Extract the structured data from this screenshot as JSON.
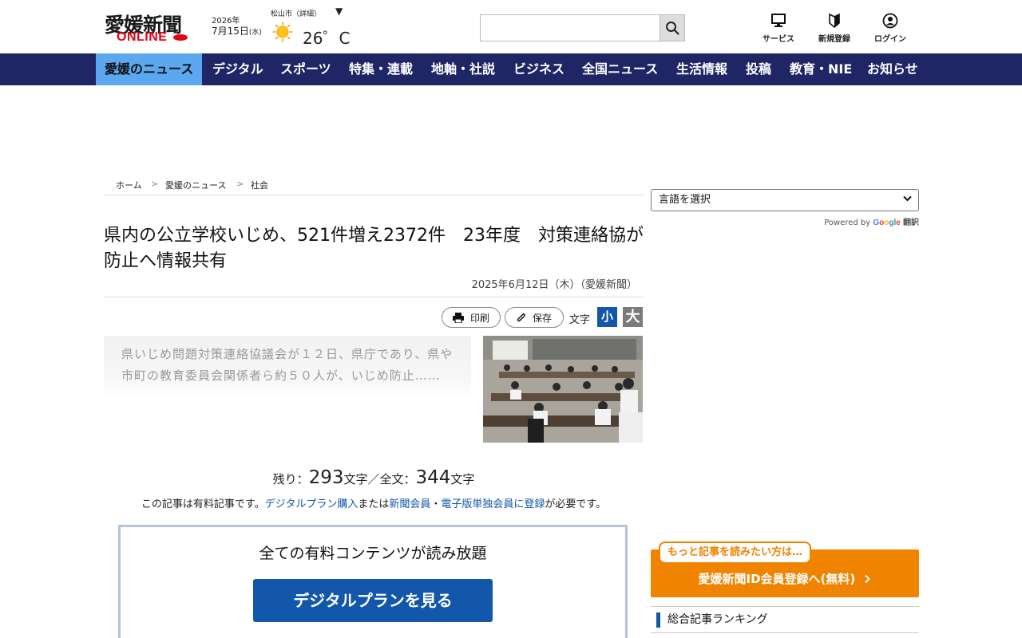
{
  "header": {
    "logo_text": "愛媛新聞",
    "logo_sub": "ONLINE",
    "date_year": "2026年",
    "date_month_day": "7月15日",
    "date_weekday": "(水)",
    "weather_city": "松山市（詳細）",
    "weather_icon": "sun-icon",
    "temperature": "26゜C",
    "search_placeholder": "",
    "icons": [
      {
        "label": "サービス",
        "icon": "monitor-icon"
      },
      {
        "label": "新規登録",
        "icon": "beginner-mark-icon"
      },
      {
        "label": "ログイン",
        "icon": "user-icon"
      }
    ]
  },
  "nav": {
    "items": [
      "愛媛のニュース",
      "デジタル",
      "スポーツ",
      "特集・連載",
      "地軸・社説",
      "ビジネス",
      "全国ニュース",
      "生活情報",
      "投稿",
      "教育・NIE",
      "お知らせ"
    ],
    "active_index": 0
  },
  "breadcrumb": {
    "items": [
      "ホーム",
      "愛媛のニュース",
      "社会"
    ],
    "separator": ">"
  },
  "article": {
    "title": "県内の公立学校いじめ、521件増え2372件　23年度　対策連絡協が防止へ情報共有",
    "published": "2025年6月12日（木）（愛媛新聞）",
    "tools": {
      "print_label": "印刷",
      "save_label": "保存",
      "font_label": "文字",
      "font_small": "小",
      "font_large": "大"
    },
    "teaser": "県いじめ問題対策連絡協議会が１２日、県庁であり、県や市町の教育委員会関係者ら約５０人が、いじめ防止……",
    "remaining_prefix": "残り：",
    "remaining_count": "293",
    "remaining_mid": "文字／全文：",
    "total_count": "344",
    "remaining_suffix": "文字",
    "paid_note": {
      "before": "この記事は有料記事です。",
      "link1": "デジタルプラン購入",
      "mid1": "または",
      "link2": "新聞会員",
      "mid2": "・",
      "link3": "電子版単独会員に登録",
      "after": "が必要です。"
    },
    "plan_heading": "全ての有料コンテンツが読み放題",
    "plan_button": "デジタルプランを見る"
  },
  "sidebar": {
    "language_select": "言語を選択",
    "powered_by": "Powered by",
    "google_translate": "翻訳",
    "register_bubble": "もっと記事を読みたい方は…",
    "register_text": "愛媛新聞ID会員登録へ(無料)",
    "ranking_heading": "総合記事ランキング"
  },
  "colors": {
    "nav_bg": "#1f2565",
    "nav_active": "#5ba8f0",
    "brand_red": "#e60012",
    "link_blue": "#1257a9",
    "register_orange": "#f08300"
  }
}
